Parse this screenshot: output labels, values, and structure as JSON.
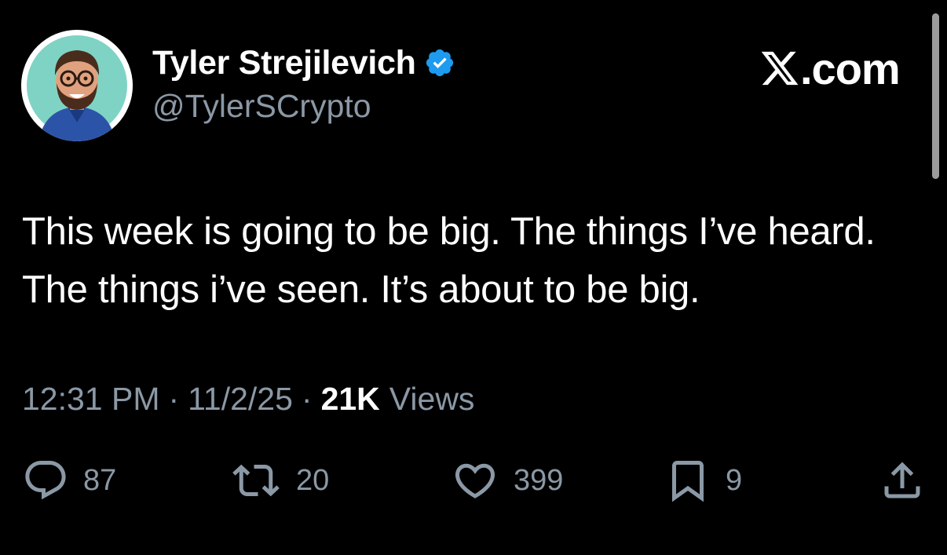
{
  "author": {
    "display_name": "Tyler Strejilevich",
    "handle": "@TylerSCrypto",
    "verified": true,
    "avatar_icon": "cartoon-avatar-bearded-man-glasses"
  },
  "brand": {
    "logo_icon": "x-logo-icon",
    "domain": ".com"
  },
  "tweet": {
    "text": "This week is going to be big. The things I’ve heard. The things i’ve seen. It’s about to be big."
  },
  "meta": {
    "time": "12:31 PM",
    "separator": "·",
    "date": "11/2/25",
    "views_count": "21K",
    "views_label": "Views"
  },
  "actions": {
    "replies": "87",
    "reposts": "20",
    "likes": "399",
    "bookmarks": "9",
    "share_icon": "share-icon"
  },
  "colors": {
    "background": "#000000",
    "primary_text": "#ffffff",
    "secondary_text": "#8b98a5",
    "verified_badge": "#1d9bf0"
  }
}
